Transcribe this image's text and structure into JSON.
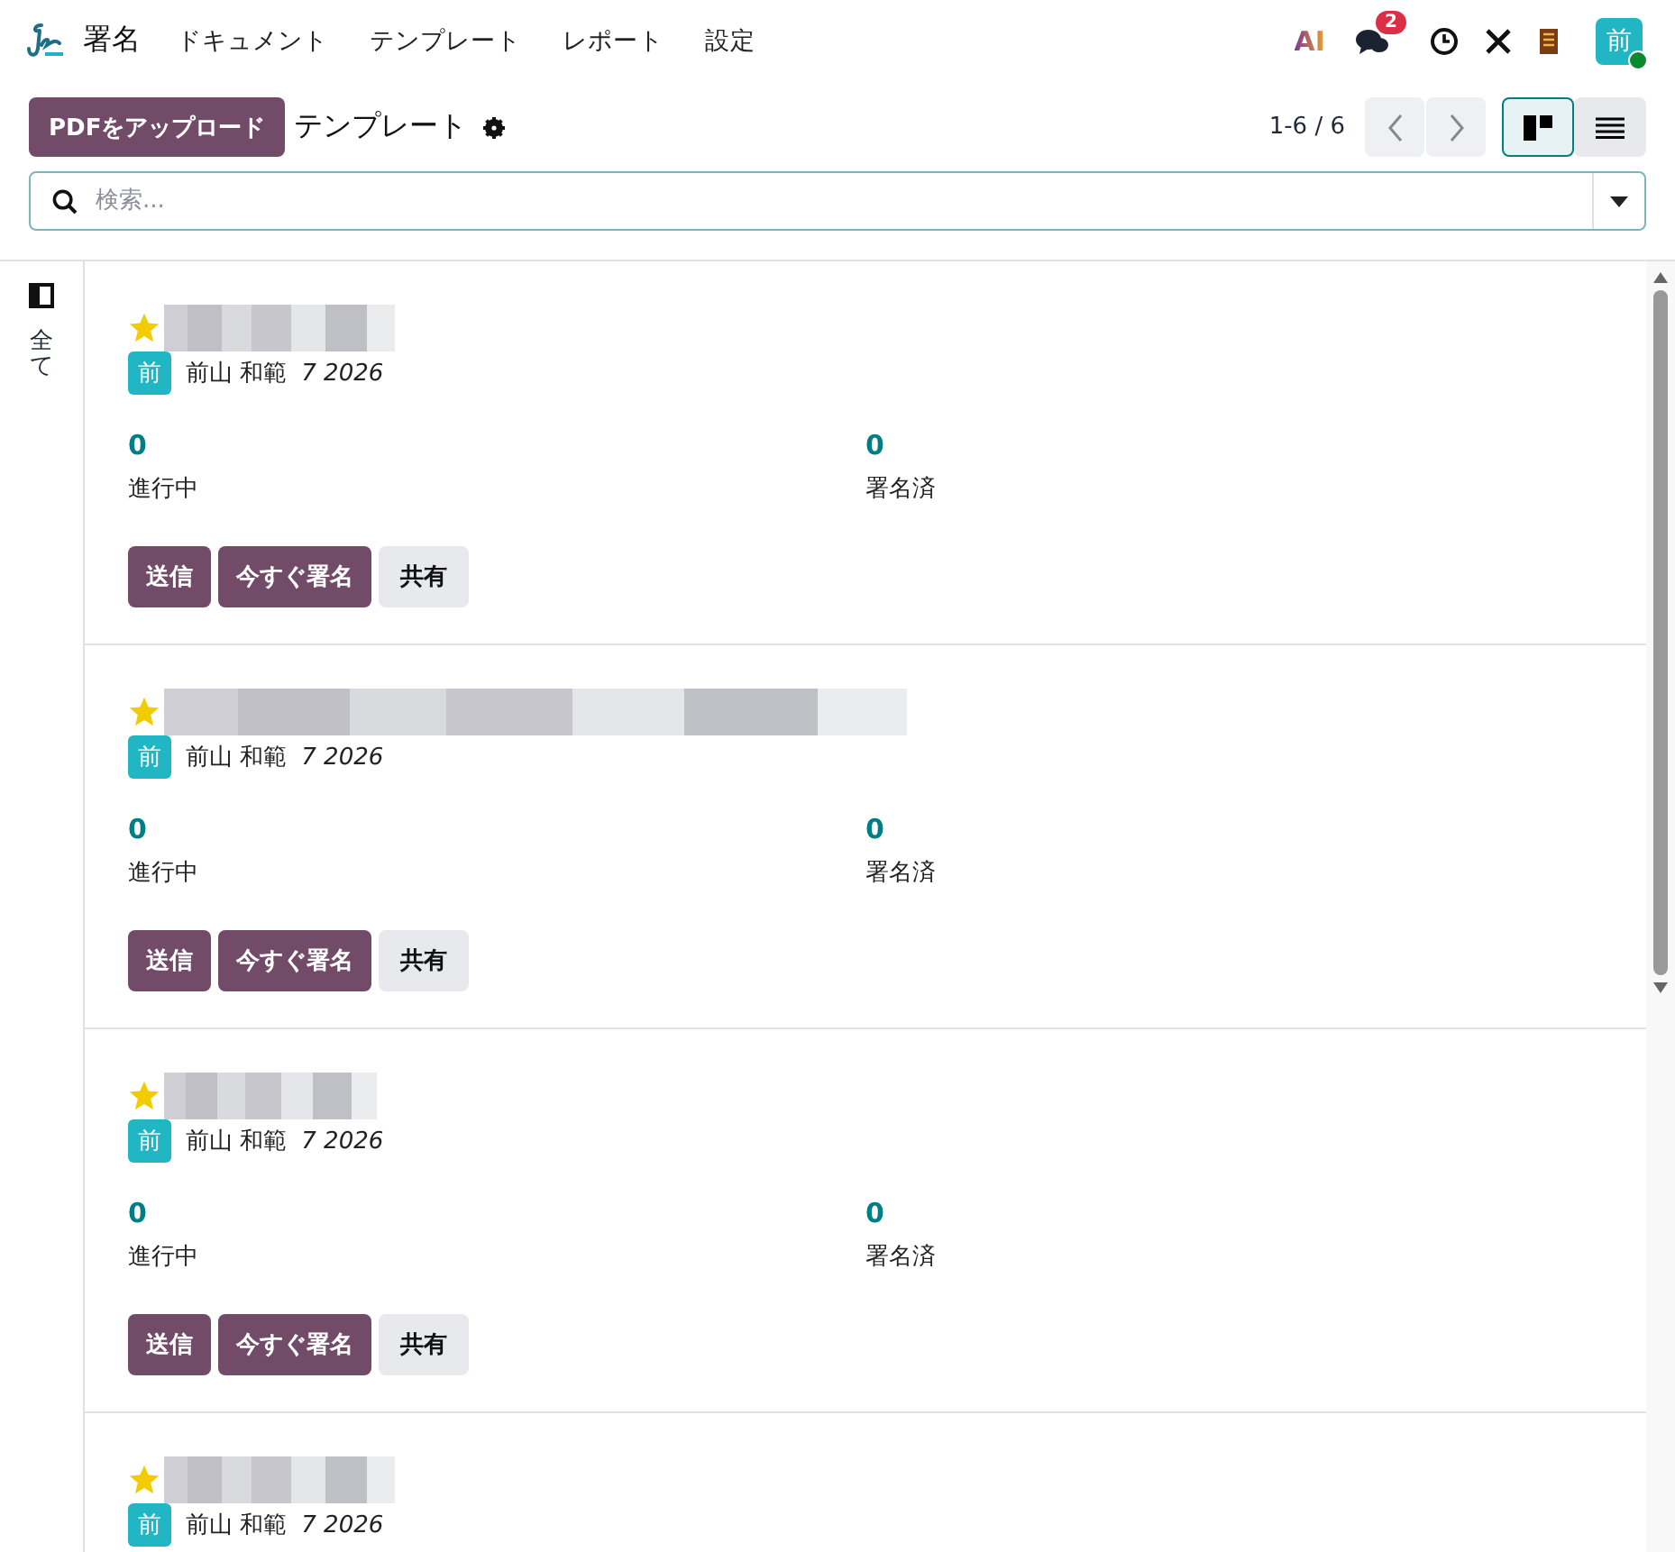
{
  "navbar": {
    "app_name": "署名",
    "menu": [
      {
        "label": "ドキュメント"
      },
      {
        "label": "テンプレート"
      },
      {
        "label": "レポート"
      },
      {
        "label": "設定"
      }
    ],
    "ai_label": "AI",
    "message_count": "2",
    "avatar_initial": "前",
    "online": true
  },
  "control_panel": {
    "upload_button": "PDFをアップロード",
    "breadcrumb": "テンプレート",
    "pager": "1-6 / 6",
    "views": [
      {
        "kind": "kanban",
        "selected": true
      },
      {
        "kind": "list",
        "selected": false
      }
    ],
    "search": {
      "placeholder": "検索..."
    }
  },
  "sidebar": {
    "label": "全て"
  },
  "templates": [
    {
      "starred": true,
      "avatar_initial": "前",
      "author": "前山 和範",
      "date": "7 2026",
      "in_progress_count": "0",
      "in_progress_label": "進行中",
      "signed_count": "0",
      "signed_label": "署名済",
      "buttons": [
        {
          "label": "送信",
          "kind": "primary"
        },
        {
          "label": "今すぐ署名",
          "kind": "primary"
        },
        {
          "label": "共有",
          "kind": "secondary"
        }
      ]
    },
    {
      "starred": true,
      "avatar_initial": "前",
      "author": "前山 和範",
      "date": "7 2026",
      "in_progress_count": "0",
      "in_progress_label": "進行中",
      "signed_count": "0",
      "signed_label": "署名済",
      "buttons": [
        {
          "label": "送信",
          "kind": "primary"
        },
        {
          "label": "今すぐ署名",
          "kind": "primary"
        },
        {
          "label": "共有",
          "kind": "secondary"
        }
      ]
    },
    {
      "starred": true,
      "avatar_initial": "前",
      "author": "前山 和範",
      "date": "7 2026",
      "in_progress_count": "0",
      "in_progress_label": "進行中",
      "signed_count": "0",
      "signed_label": "署名済",
      "buttons": [
        {
          "label": "送信",
          "kind": "primary"
        },
        {
          "label": "今すぐ署名",
          "kind": "primary"
        },
        {
          "label": "共有",
          "kind": "secondary"
        }
      ]
    },
    {
      "starred": true,
      "avatar_initial": "前",
      "author": "前山 和範",
      "date": "7 2026"
    }
  ]
}
